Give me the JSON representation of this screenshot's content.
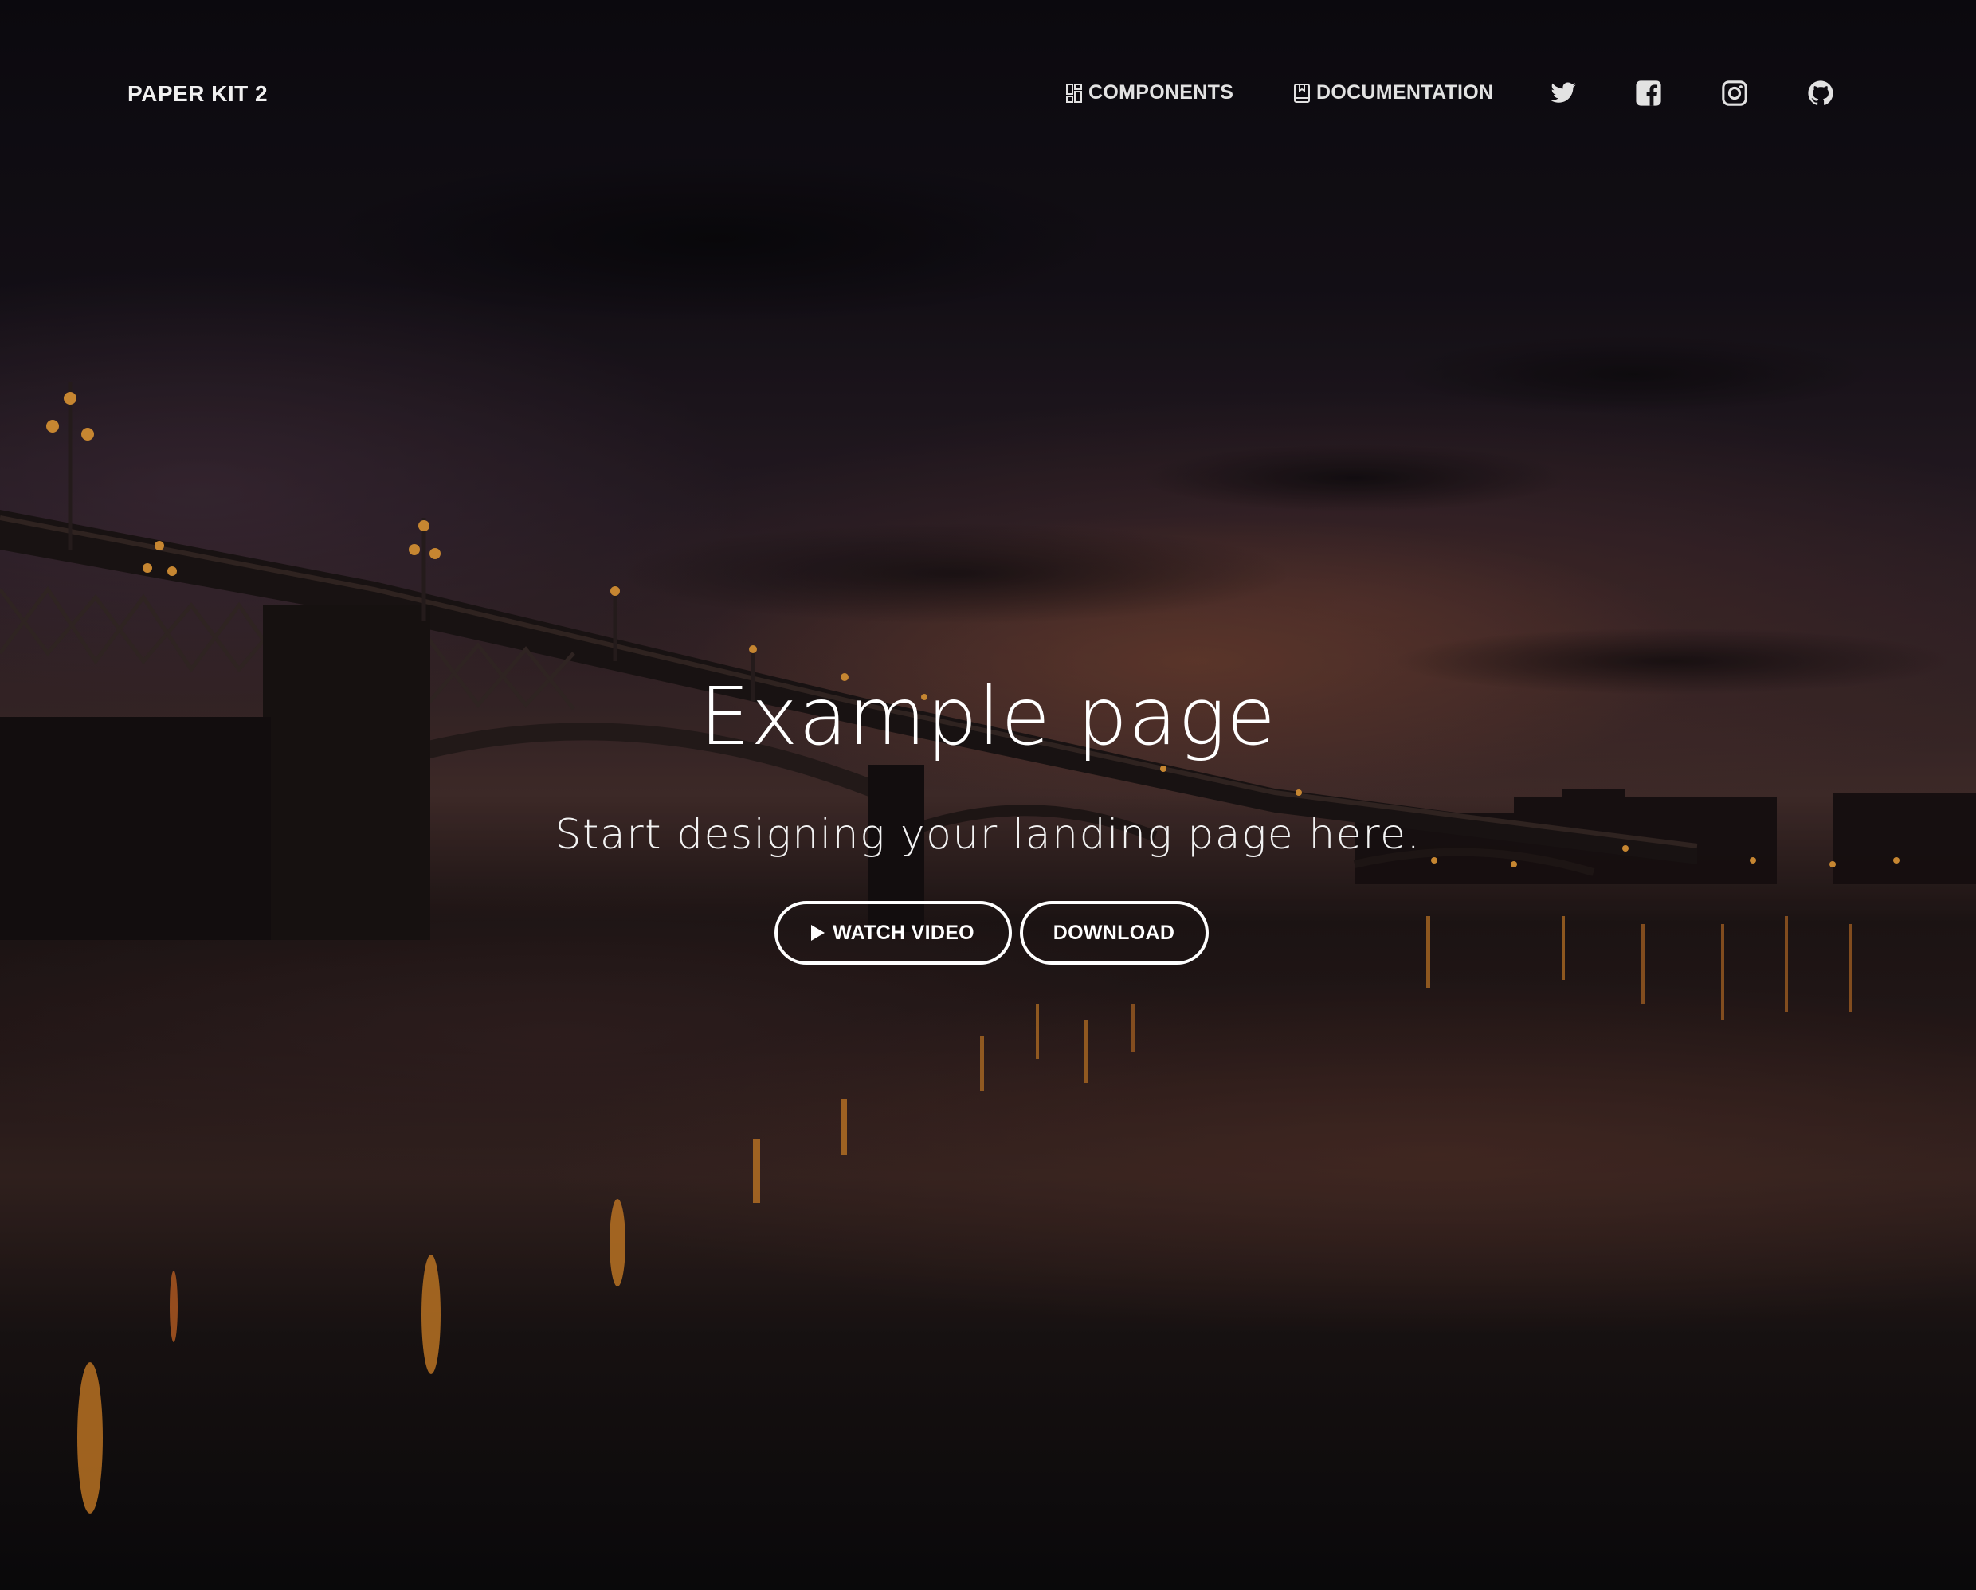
{
  "navbar": {
    "brand": "PAPER KIT 2",
    "links": [
      {
        "label": "COMPONENTS",
        "icon": "layout-grid-icon"
      },
      {
        "label": "DOCUMENTATION",
        "icon": "book-bookmark-icon"
      }
    ],
    "social": [
      {
        "name": "twitter",
        "icon": "twitter-icon"
      },
      {
        "name": "facebook",
        "icon": "facebook-square-icon"
      },
      {
        "name": "instagram",
        "icon": "instagram-icon"
      },
      {
        "name": "github",
        "icon": "github-icon"
      }
    ]
  },
  "hero": {
    "title": "Example page",
    "subtitle": "Start designing your landing page here.",
    "buttons": [
      {
        "label": "WATCH VIDEO",
        "icon": "play-icon"
      },
      {
        "label": "DOWNLOAD"
      }
    ],
    "background": "night bridge over river with city lights reflected in water"
  },
  "colors": {
    "text": "#ffffff",
    "nav_text": "#e2e2e2",
    "overlay": "#000000"
  }
}
